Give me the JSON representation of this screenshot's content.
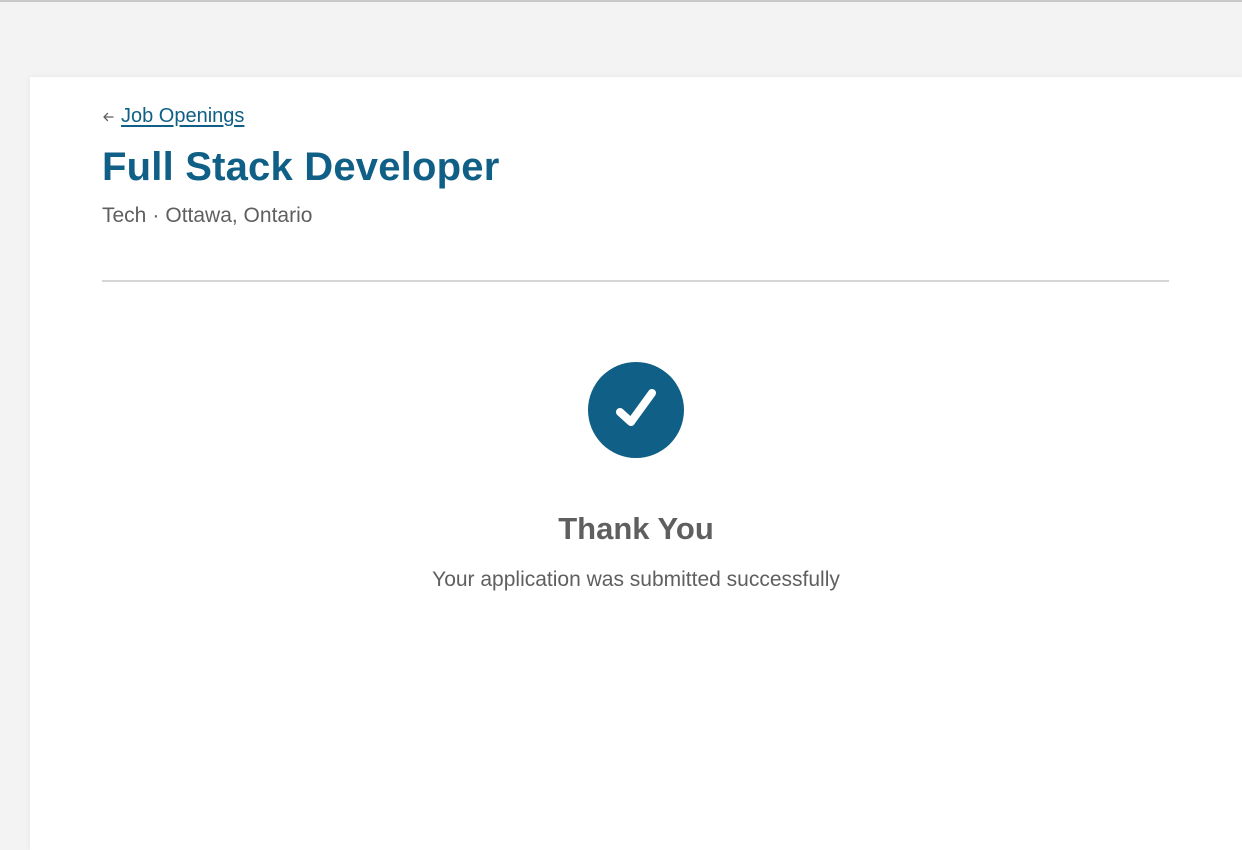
{
  "header": {
    "back_link_label": "Job Openings",
    "job_title": "Full Stack Developer",
    "department": "Tech",
    "separator": "·",
    "location": "Ottawa, Ontario"
  },
  "confirmation": {
    "icon": "checkmark-icon",
    "heading": "Thank You",
    "message": "Your application was submitted successfully"
  },
  "colors": {
    "brand": "#0f5f86",
    "text_muted": "#5f5f5f",
    "page_background": "#f3f3f3",
    "card_background": "#ffffff",
    "divider": "#d6d6d6"
  }
}
